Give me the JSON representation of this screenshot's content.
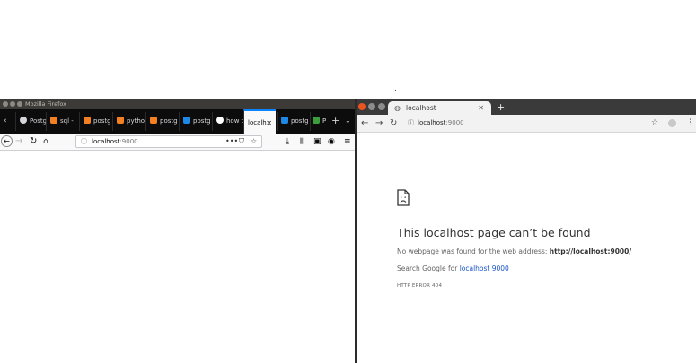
{
  "firefox": {
    "window_title": "Mozilla Firefox",
    "tabs": [
      {
        "label": "Postg",
        "icon": "github-icon",
        "color": "#d7d7db"
      },
      {
        "label": "sql -",
        "icon": "stackoverflow-icon",
        "color": "#f48024"
      },
      {
        "label": "postg",
        "icon": "stackoverflow-icon",
        "color": "#f48024"
      },
      {
        "label": "pytho",
        "icon": "stackoverflow-icon",
        "color": "#f48024"
      },
      {
        "label": "postg",
        "icon": "stackoverflow-icon",
        "color": "#f48024"
      },
      {
        "label": "postg",
        "icon": "postgres-doc-icon",
        "color": "#1e88e5"
      },
      {
        "label": "how t",
        "icon": "google-icon",
        "color": "#ffffff"
      },
      {
        "label": "localh",
        "icon": "",
        "color": "",
        "active": true
      },
      {
        "label": "postg",
        "icon": "postgres-doc-icon",
        "color": "#1e88e5"
      },
      {
        "label": "P",
        "icon": "green-icon",
        "color": "#3c9d3c"
      }
    ],
    "url_host": "localhost",
    "url_port": ":9000"
  },
  "chrome": {
    "tab_title": "localhost",
    "url_host": "localhost",
    "url_port": ":9000",
    "error": {
      "title": "This localhost page can’t be found",
      "message_prefix": "No webpage was found for the web address: ",
      "message_url": "http://localhost:9000/",
      "search_prefix": "Search Google for ",
      "search_link": "localhost 9000",
      "code": "HTTP ERROR 404"
    }
  },
  "colors": {
    "firefox_tabbar": "#0c0c0d",
    "firefox_active_accent": "#0a84ff",
    "chrome_tabbar": "#3a3a3a",
    "link": "#1a55c9"
  }
}
